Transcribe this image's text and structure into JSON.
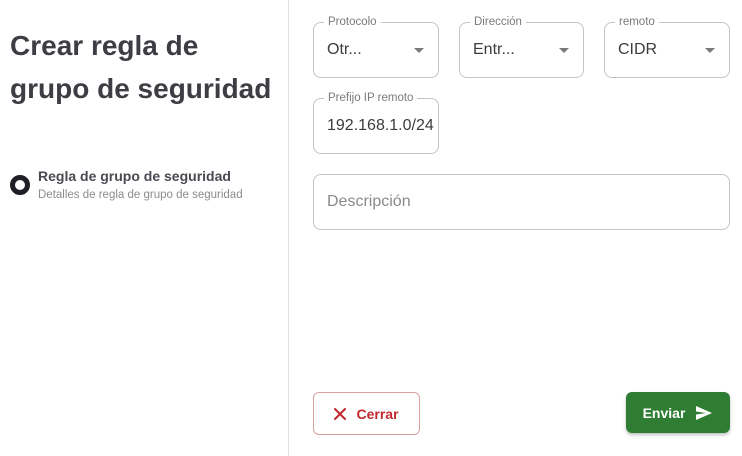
{
  "header": {
    "title": "Crear regla de grupo de seguridad"
  },
  "stepper": {
    "steps": [
      {
        "label": "Regla de grupo de seguridad",
        "sublabel": "Detalles de regla de grupo de seguridad"
      }
    ]
  },
  "form": {
    "protocolo": {
      "label": "Protocolo",
      "value": "Otr..."
    },
    "direccion": {
      "label": "Dirección",
      "value": "Entr..."
    },
    "remoto": {
      "label": "remoto",
      "value": "CIDR"
    },
    "prefijo": {
      "label": "Prefijo IP remoto",
      "value": "192.168.1.0/24"
    },
    "descripcion": {
      "placeholder": "Descripción"
    }
  },
  "actions": {
    "cancel_label": "Cerrar",
    "submit_label": "Enviar"
  },
  "colors": {
    "submit_bg": "#2e7d32",
    "cancel_text": "#c1272d",
    "step_dot": "#1f1f28"
  },
  "icons": {
    "cancel": "close-icon",
    "submit": "send-icon",
    "select": "caret-down-icon"
  }
}
